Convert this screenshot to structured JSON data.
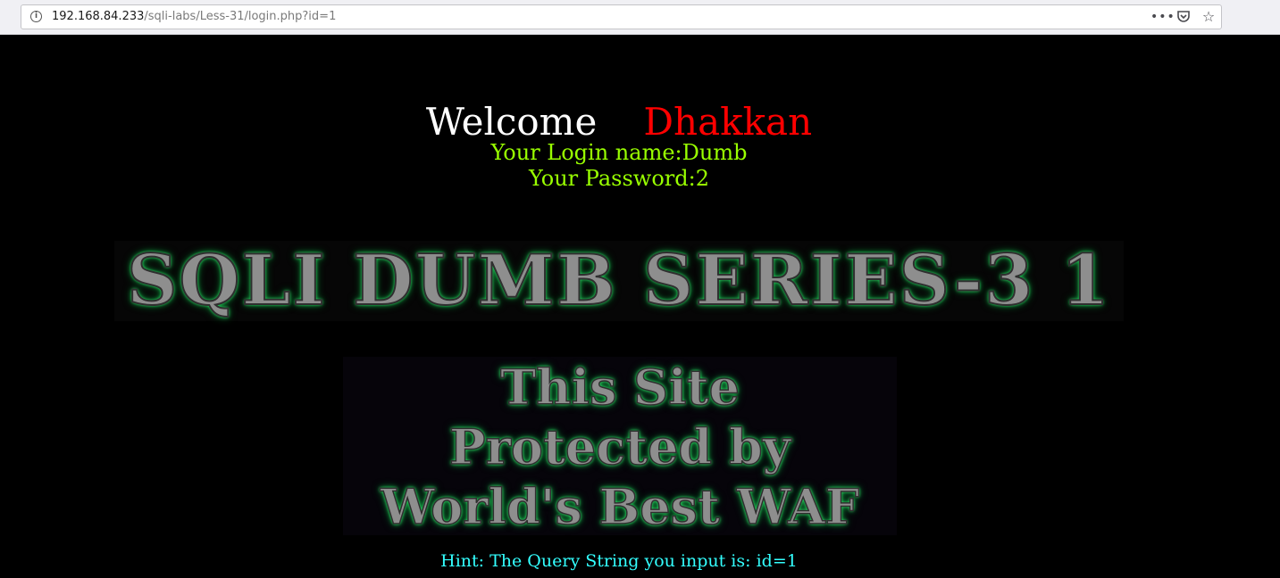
{
  "browser": {
    "url_host": "192.168.84.233",
    "url_path": "/sqli-labs/Less-31/login.php?id=1",
    "info_icon": "info-icon",
    "more_icon": "more-actions-icon",
    "pocket_icon": "pocket-icon",
    "bookmark_icon": "star-icon"
  },
  "page": {
    "welcome_label": "Welcome",
    "welcome_name": "Dhakkan",
    "login_name_line": "Your Login name:Dumb",
    "password_line": "Your Password:2",
    "banner_title": "SQLI DUMB SERIES-3 1",
    "waf_lines": [
      "This Site",
      "Protected by",
      "World's Best WAF"
    ],
    "hint": "Hint: The Query String you input is: id=1"
  },
  "colors": {
    "background": "#000000",
    "welcome": "#ffffff",
    "name": "#ff0000",
    "credentials": "#99ff00",
    "hint": "#33ffff",
    "glow": "#3cff7a"
  }
}
